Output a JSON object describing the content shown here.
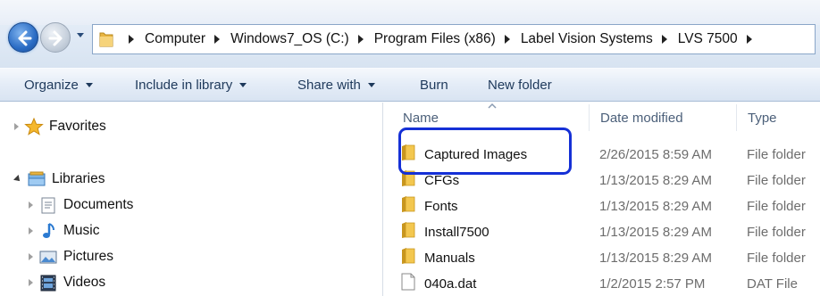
{
  "address_bar": {
    "crumbs": [
      "Computer",
      "Windows7_OS (C:)",
      "Program Files (x86)",
      "Label Vision Systems",
      "LVS 7500"
    ]
  },
  "toolbar": {
    "organize": "Organize",
    "include_in_library": "Include in library",
    "share_with": "Share with",
    "burn": "Burn",
    "new_folder": "New folder"
  },
  "nav_pane": {
    "favorites": "Favorites",
    "libraries": "Libraries",
    "documents": "Documents",
    "music": "Music",
    "pictures": "Pictures",
    "videos": "Videos"
  },
  "columns": {
    "name": "Name",
    "date_modified": "Date modified",
    "type": "Type"
  },
  "files": [
    {
      "name": "Captured Images",
      "date": "2/26/2015 8:59 AM",
      "type": "File folder",
      "icon": "folder-icon"
    },
    {
      "name": "CFGs",
      "date": "1/13/2015 8:29 AM",
      "type": "File folder",
      "icon": "folder-icon"
    },
    {
      "name": "Fonts",
      "date": "1/13/2015 8:29 AM",
      "type": "File folder",
      "icon": "folder-icon"
    },
    {
      "name": "Install7500",
      "date": "1/13/2015 8:29 AM",
      "type": "File folder",
      "icon": "folder-icon"
    },
    {
      "name": "Manuals",
      "date": "1/13/2015 8:29 AM",
      "type": "File folder",
      "icon": "folder-icon"
    },
    {
      "name": "040a.dat",
      "date": "1/2/2015 2:57 PM",
      "type": "DAT File",
      "icon": "file-icon"
    }
  ],
  "colors": {
    "highlight_border": "#1530d6",
    "toolbar_text": "#1e395b",
    "secondary_text": "#6d6d6d"
  }
}
